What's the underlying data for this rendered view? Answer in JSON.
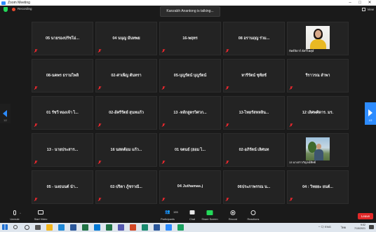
{
  "window": {
    "title": "Zoom Meeting",
    "minimize": "–",
    "maximize": "□",
    "close": "✕"
  },
  "topbar": {
    "recording_label": "Recording",
    "talking": "Kanzabh Anantong is talking...",
    "view_label": "View"
  },
  "tiles": [
    {
      "name": "05 นายรองปรัชโม่...",
      "muted": true
    },
    {
      "name": "04 นนุญ มั่นทพย",
      "muted": true
    },
    {
      "name": "16-พฤทร",
      "muted": true
    },
    {
      "name": "08 อรานฤญ ร่วม...",
      "muted": true
    },
    {
      "name": "",
      "caption": "ปัทธ์จิตาร์ ค์ทวีไพศุษ์",
      "muted": false,
      "video": "p1"
    },
    {
      "name": "08-นคพร ธรามไพลิ",
      "muted": true
    },
    {
      "name": "02-ศาเพ็ญ ตันทรา",
      "muted": true
    },
    {
      "name": "05-บุญรัตน์ บุญรัตน์",
      "muted": true
    },
    {
      "name": "หารีรัตน์ ชุทัยช์",
      "muted": true
    },
    {
      "name": "รีราวรณ ลำพา",
      "muted": true
    },
    {
      "name": "01 รัชวี ทองเจ้า ไ...",
      "muted": true
    },
    {
      "name": "02-อัครีรัตย์ สุนทแก้ว",
      "muted": true
    },
    {
      "name": "13 -หลักสูตรวิศวก...",
      "muted": true
    },
    {
      "name": "13-ไทยรัสหหลิน...",
      "muted": true
    },
    {
      "name": "12 เลิศพศิดาร. มร.",
      "muted": true
    },
    {
      "name": "13 - นายประสาร...",
      "muted": true
    },
    {
      "name": "16 นสดต้อม แก้ว...",
      "muted": true
    },
    {
      "name": "01 จตนธ์ (ฮอม ไ...",
      "muted": true
    },
    {
      "name": "02-อภิรัตน์ เลิศนท",
      "muted": true
    },
    {
      "name": "",
      "caption": "13 นางสาวกัญจน์ทิพย์",
      "muted": false,
      "video": "p2"
    },
    {
      "name": "05 - นงธนนต์ นำ...",
      "muted": true
    },
    {
      "name": "02-ปริตา ภู้ชราณั...",
      "muted": true
    },
    {
      "name": "04 Juthamas.j",
      "muted": true
    },
    {
      "name": "06ประภาพรรณ น...",
      "muted": true
    },
    {
      "name": "04 : วิทยยะ ยนต์...",
      "muted": true
    }
  ],
  "nav": {
    "left_page": "1/2",
    "right_page": "1/2"
  },
  "toolbar": {
    "unmute": "Unmute",
    "start_video": "Start Video",
    "participants": "Participants",
    "participants_count": "155",
    "chat": "Chat",
    "share_screen": "Share Screen",
    "record": "Record",
    "reactions": "Reactions",
    "leave": "Leave",
    "caret": "^"
  },
  "taskbar": {
    "tray": "^ 🗨 ENG",
    "lang": "ไทย",
    "time": "9:02",
    "date": "7/15/2021"
  },
  "colors": {
    "accent": "#2d8cff",
    "share": "#23d959",
    "leave": "#e02828",
    "muted": "#e0282e"
  }
}
